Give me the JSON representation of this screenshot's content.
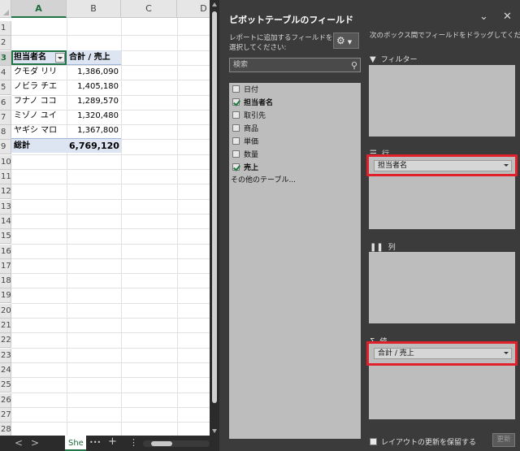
{
  "sheet": {
    "columns": [
      "A",
      "B",
      "C",
      "D"
    ],
    "rows": [
      "1",
      "2",
      "3",
      "4",
      "5",
      "6",
      "7",
      "8",
      "9",
      "10",
      "11",
      "12",
      "13",
      "14",
      "15",
      "16",
      "17",
      "18",
      "19",
      "20",
      "21",
      "22",
      "23",
      "24",
      "25",
      "26",
      "27",
      "28"
    ],
    "header_a": "担当者名",
    "header_b": "合計 / 売上",
    "data": [
      {
        "name": "クモダ リリ",
        "value": "1,386,090"
      },
      {
        "name": "ノビラ チエ",
        "value": "1,405,180"
      },
      {
        "name": "フナノ ココ",
        "value": "1,289,570"
      },
      {
        "name": "ミゾノ ユイ",
        "value": "1,320,480"
      },
      {
        "name": "ヤギシ マロ",
        "value": "1,367,800"
      }
    ],
    "total_label": "総計",
    "total_value": "6,769,120",
    "tab_name": "She",
    "tab_ellipsis": "•••",
    "tab_add": "+",
    "tab_more": "⋮",
    "nav_prev": "<",
    "nav_next": ">"
  },
  "pane": {
    "title": "ピボットテーブルのフィールド",
    "add_desc": "レポートに追加するフィールドを選択してください:",
    "drag_desc": "次のボックス間でフィールドをドラッグしてください:",
    "search_placeholder": "検索",
    "fields": [
      {
        "label": "日付",
        "checked": false
      },
      {
        "label": "担当者名",
        "checked": true
      },
      {
        "label": "取引先",
        "checked": false
      },
      {
        "label": "商品",
        "checked": false
      },
      {
        "label": "単価",
        "checked": false
      },
      {
        "label": "数量",
        "checked": false
      },
      {
        "label": "売上",
        "checked": true
      }
    ],
    "other_tables": "その他のテーブル...",
    "areas": {
      "filter": "フィルター",
      "rows": "行",
      "columns": "列",
      "values": "値"
    },
    "rows_chip": "担当者名",
    "values_chip": "合計 / 売上",
    "defer_label": "レイアウトの更新を保留する",
    "update_label": "更新"
  },
  "colors": {
    "highlight": "#e0202a",
    "accent": "#217346"
  }
}
